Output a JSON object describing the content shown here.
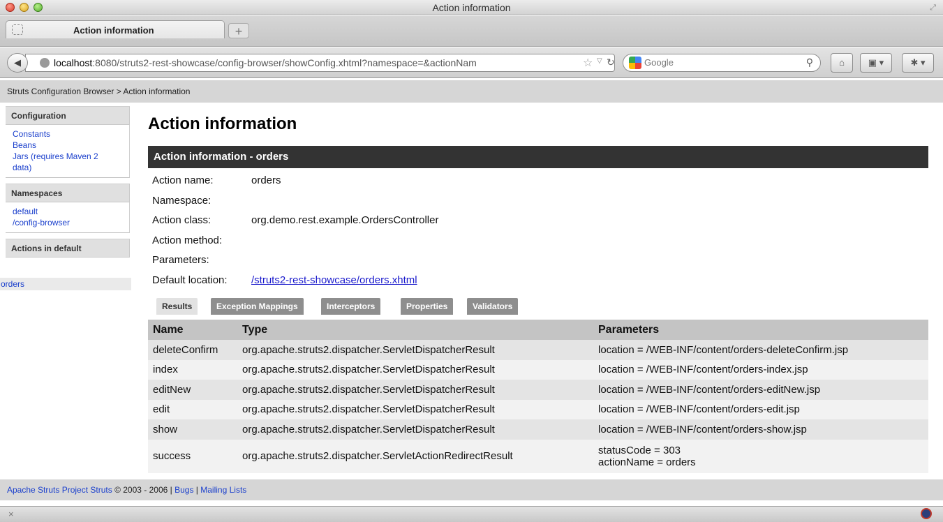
{
  "window": {
    "title": "Action information"
  },
  "tab": {
    "title": "Action information",
    "new_tab": "+"
  },
  "nav": {
    "back": "◀",
    "url_host": "localhost",
    "url_rest": ":8080/struts2-rest-showcase/config-browser/showConfig.xhtml?namespace=&actionNam",
    "search_engine": "Google"
  },
  "breadcrumb": "Struts Configuration Browser > Action information",
  "sidebar": {
    "configuration": {
      "heading": "Configuration",
      "links": [
        "Constants",
        "Beans",
        "Jars (requires Maven 2",
        "data)"
      ]
    },
    "namespaces": {
      "heading": "Namespaces",
      "links": [
        "default",
        "/config-browser"
      ]
    },
    "actions": {
      "heading": "Actions in default",
      "links": [
        "orders"
      ]
    }
  },
  "main": {
    "title": "Action information",
    "section_title": "Action information - orders",
    "info": [
      {
        "label": "Action name:",
        "value": "orders"
      },
      {
        "label": "Namespace:",
        "value": ""
      },
      {
        "label": "Action class:",
        "value": "org.demo.rest.example.OrdersController"
      },
      {
        "label": "Action method:",
        "value": ""
      },
      {
        "label": "Parameters:",
        "value": ""
      },
      {
        "label": "Default location:",
        "value": "/struts2-rest-showcase/orders.xhtml"
      }
    ],
    "tabs": [
      "Results",
      "Exception Mappings",
      "Interceptors",
      "Properties",
      "Validators"
    ],
    "table": {
      "headers": [
        "Name",
        "Type",
        "Parameters"
      ],
      "rows": [
        {
          "name": "deleteConfirm",
          "type": "org.apache.struts2.dispatcher.ServletDispatcherResult",
          "params": [
            "location = /WEB-INF/content/orders-deleteConfirm.jsp"
          ]
        },
        {
          "name": "index",
          "type": "org.apache.struts2.dispatcher.ServletDispatcherResult",
          "params": [
            "location = /WEB-INF/content/orders-index.jsp"
          ]
        },
        {
          "name": "editNew",
          "type": "org.apache.struts2.dispatcher.ServletDispatcherResult",
          "params": [
            "location = /WEB-INF/content/orders-editNew.jsp"
          ]
        },
        {
          "name": "edit",
          "type": "org.apache.struts2.dispatcher.ServletDispatcherResult",
          "params": [
            "location = /WEB-INF/content/orders-edit.jsp"
          ]
        },
        {
          "name": "show",
          "type": "org.apache.struts2.dispatcher.ServletDispatcherResult",
          "params": [
            "location = /WEB-INF/content/orders-show.jsp"
          ]
        },
        {
          "name": "success",
          "type": "org.apache.struts2.dispatcher.ServletActionRedirectResult",
          "params": [
            "statusCode = 303",
            "actionName = orders"
          ]
        }
      ]
    }
  },
  "footer": {
    "project_link": "Apache Struts Project Struts",
    "copyright": " © 2003 - 2006 | ",
    "bugs": "Bugs",
    "separator": " | ",
    "mailing": "Mailing Lists"
  },
  "status": {
    "close": "×"
  }
}
